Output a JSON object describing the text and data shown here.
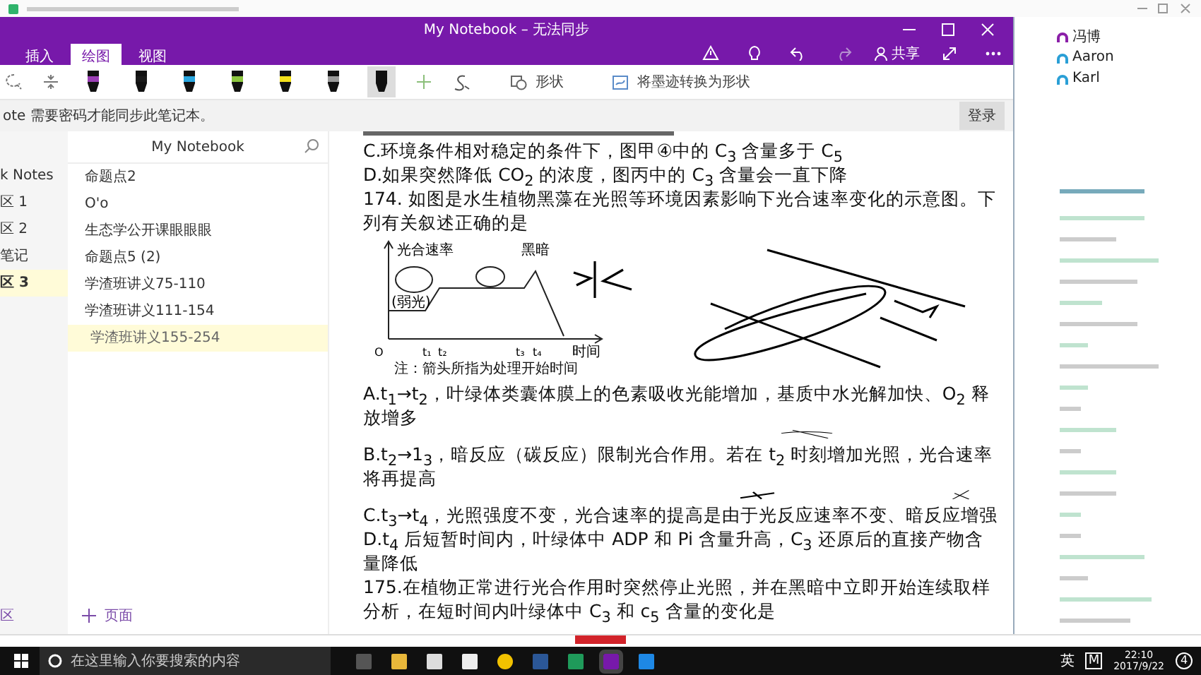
{
  "window": {
    "title": "My Notebook – 无法同步"
  },
  "ribbon_tabs": [
    {
      "label": "插入",
      "selected": false
    },
    {
      "label": "绘图",
      "selected": true
    },
    {
      "label": "视图",
      "selected": false
    }
  ],
  "share": {
    "label": "共享"
  },
  "pens": [
    {
      "color": "#9b3fb5",
      "selected": false
    },
    {
      "color": "#1a1a1a",
      "selected": false
    },
    {
      "color": "#2aa7e0",
      "selected": false
    },
    {
      "color": "#8cc63f",
      "selected": false
    },
    {
      "color": "#f5e21c",
      "selected": false
    },
    {
      "color": "#9a9a9a",
      "selected": false
    },
    {
      "color": "#111111",
      "selected": true
    }
  ],
  "toolbar": {
    "shapes": "形状",
    "ink_to_shape": "将墨迹转换为形状"
  },
  "info_bar": {
    "message": "ote 需要密码才能同步此笔记本。",
    "button": "登录"
  },
  "sections": [
    {
      "label": "k Notes",
      "selected": false
    },
    {
      "label": "区 1",
      "selected": false
    },
    {
      "label": "区 2",
      "selected": false
    },
    {
      "label": "笔记",
      "selected": false
    },
    {
      "label": "区 3",
      "selected": true
    }
  ],
  "sections_footer": "区",
  "notebook": {
    "title": "My Notebook"
  },
  "pages": [
    {
      "label": "命题点2",
      "selected": false
    },
    {
      "label": "O'o",
      "selected": false
    },
    {
      "label": "生态学公开课眼眼眼",
      "selected": false
    },
    {
      "label": "命题点5 (2)",
      "selected": false
    },
    {
      "label": "学渣班讲义75-110",
      "selected": false
    },
    {
      "label": "学渣班讲义111-154",
      "selected": false
    },
    {
      "label": "学渣班讲义155-254",
      "selected": true
    }
  ],
  "add_page": "页面",
  "content": {
    "lines_before": [
      "C.环境条件相对稳定的条件下，图甲④中的 C$_{3}$ 含量多于 C$_{5}$",
      "D.如果突然降低 CO$_{2}$ 的浓度，图丙中的 C$_{3}$ 含量会一直下降",
      "174. 如图是水生植物黑藻在光照等环境因素影响下光合速率变化的示意图。下列有关叙述正确的是"
    ],
    "figure": {
      "y_axis": "光合速率",
      "dark": "黑暗",
      "weak_light": "(弱光)",
      "x_axis": "时间",
      "origin": "O",
      "ticks": [
        "t₁",
        "t₂",
        "t₃",
        "t₄"
      ],
      "note": "注：箭头所指为处理开始时间"
    },
    "lines_after": [
      "A.t$_{1}$→t$_{2}$，叶绿体类囊体膜上的色素吸收光能增加，基质中水光解加快、O$_{2}$ 释放增多",
      "B.t$_{2}$→1$_{3}$，暗反应（碳反应）限制光合作用。若在 t$_{2}$ 时刻增加光照，光合速率将再提高",
      "C.t$_{3}$→t$_{4}$，光照强度不变，光合速率的提高是由于光反应速率不变、暗反应增强",
      "D.t$_{4}$ 后短暂时间内，叶绿体中 ADP 和 Pi 含量升高，C$_{3}$ 还原后的直接产物含量降低",
      "175.在植物正常进行光合作用时突然停止光照，并在黑暗中立即开始连续取样分析，在短时间内叶绿体中 C$_{3}$ 和 c$_{5}$ 含量的变化是"
    ]
  },
  "participants": [
    {
      "name": "冯博",
      "color": "#8b1fa8"
    },
    {
      "name": "Aaron",
      "color": "#2a9fd6"
    },
    {
      "name": "Karl",
      "color": "#2a9fd6"
    }
  ],
  "taskbar": {
    "search_placeholder": "在这里输入你要搜索的内容",
    "ime": "英",
    "ime_mode": "M",
    "time": "22:10",
    "date": "2017/9/22",
    "notifications": "4"
  }
}
